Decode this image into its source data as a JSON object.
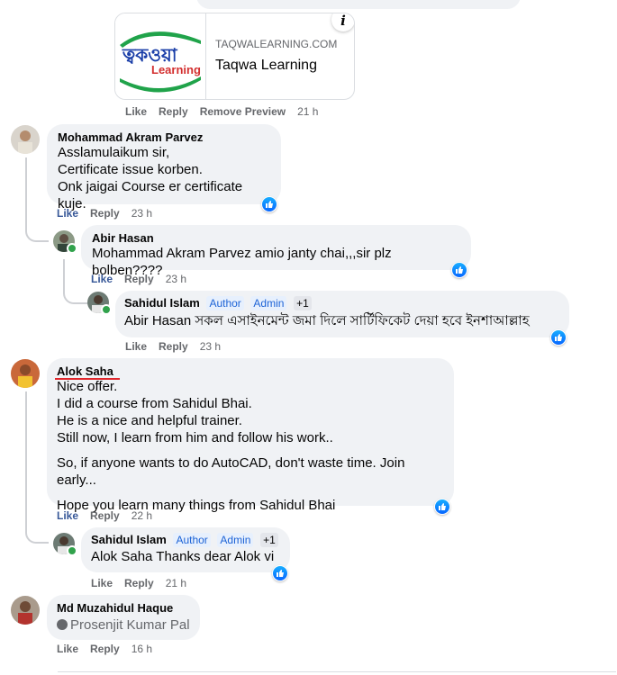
{
  "top_bubble_fragment": "…… …… …… ……",
  "preview": {
    "domain": "TAQWALEARNING.COM",
    "title": "Taqwa Learning",
    "logo_text_top": "ত্বকওয়া",
    "logo_text_bottom": "Learning",
    "info_icon": "i"
  },
  "preview_actions": {
    "like": "Like",
    "reply": "Reply",
    "remove": "Remove Preview",
    "time": "21 h"
  },
  "comments": [
    {
      "author": "Mohammad Akram Parvez",
      "lines": [
        "Asslamulaikum sir,",
        "Certificate issue korben.",
        "Onk jaigai Course er certificate kuje."
      ],
      "like": "Like",
      "reply": "Reply",
      "time": "23 h"
    },
    {
      "author": "Abir Hasan",
      "mention": "Mohammad Akram Parvez",
      "text": " amio janty chai,,,sir plz bolben????",
      "like": "Like",
      "reply": "Reply",
      "time": "23 h"
    },
    {
      "author": "Sahidul Islam",
      "badges": [
        "Author",
        "Admin",
        "+1"
      ],
      "mention": "Abir Hasan",
      "text": " সকল এসাইনমেন্ট জমা দিলে সার্টিফিকেট দেয়া হবে ইনশাআল্লাহ",
      "like": "Like",
      "reply": "Reply",
      "time": "23 h"
    },
    {
      "author": "Alok Saha",
      "lines": [
        "Nice offer.",
        "I did a course from Sahidul Bhai.",
        "He is a nice and helpful trainer.",
        "Still now, I learn from him and follow his work.."
      ],
      "para2": "So, if anyone wants to do AutoCAD, don't waste time. Join early...",
      "para3": "Hope you learn many things from Sahidul Bhai",
      "like": "Like",
      "reply": "Reply",
      "time": "22 h"
    },
    {
      "author": "Sahidul Islam",
      "badges": [
        "Author",
        "Admin",
        "+1"
      ],
      "mention": "Alok Saha",
      "text": " Thanks dear Alok vi",
      "like": "Like",
      "reply": "Reply",
      "time": "21 h"
    },
    {
      "author": "Md Muzahidul Haque",
      "tag": "Prosenjit Kumar Pal",
      "like": "Like",
      "reply": "Reply",
      "time": "16 h"
    }
  ],
  "colors": {
    "like_blue": "#385898",
    "bubble": "#f0f2f5",
    "underline_red": "#e0262b",
    "online": "#31a24c"
  }
}
